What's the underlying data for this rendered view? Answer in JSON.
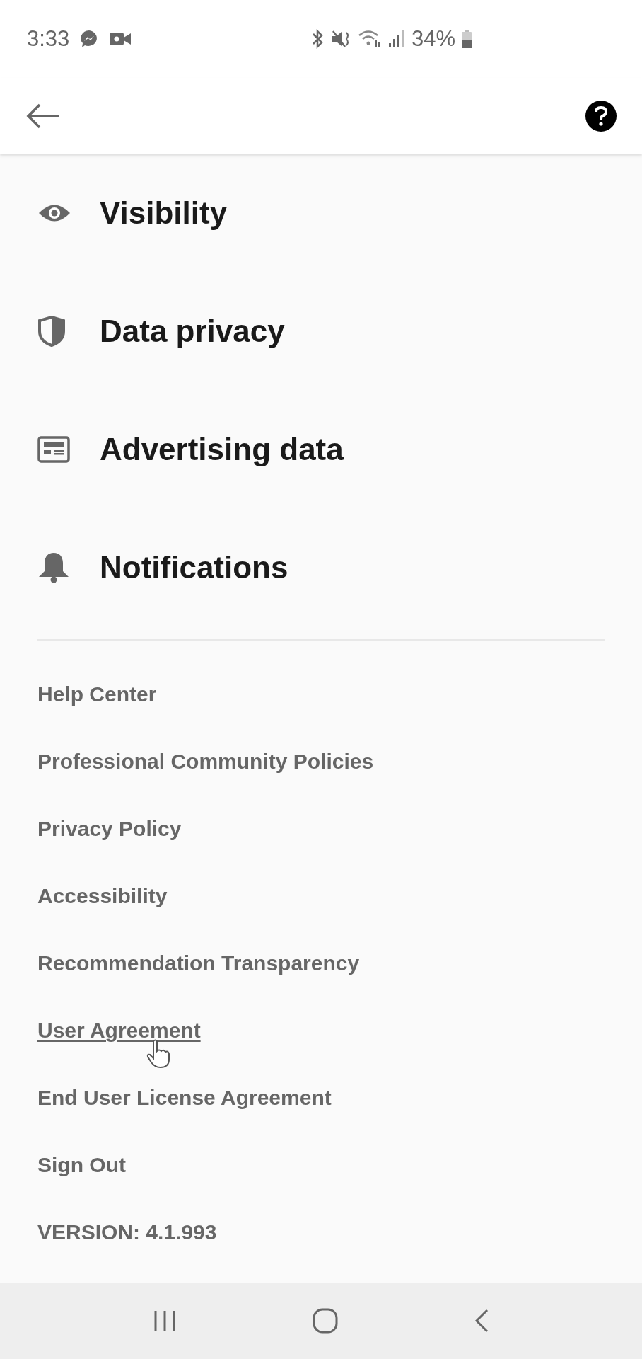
{
  "status_bar": {
    "time": "3:33",
    "battery": "34%"
  },
  "settings": [
    {
      "kind": "eye",
      "label": "Visibility"
    },
    {
      "kind": "shield",
      "label": "Data privacy"
    },
    {
      "kind": "ad",
      "label": "Advertising data"
    },
    {
      "kind": "bell",
      "label": "Notifications"
    }
  ],
  "links": [
    {
      "label": "Help Center",
      "hovered": false
    },
    {
      "label": "Professional Community Policies",
      "hovered": false
    },
    {
      "label": "Privacy Policy",
      "hovered": false
    },
    {
      "label": "Accessibility",
      "hovered": false
    },
    {
      "label": "Recommendation Transparency",
      "hovered": false
    },
    {
      "label": "User Agreement",
      "hovered": true
    },
    {
      "label": "End User License Agreement",
      "hovered": false
    },
    {
      "label": "Sign Out",
      "hovered": false
    }
  ],
  "version": "VERSION: 4.1.993"
}
